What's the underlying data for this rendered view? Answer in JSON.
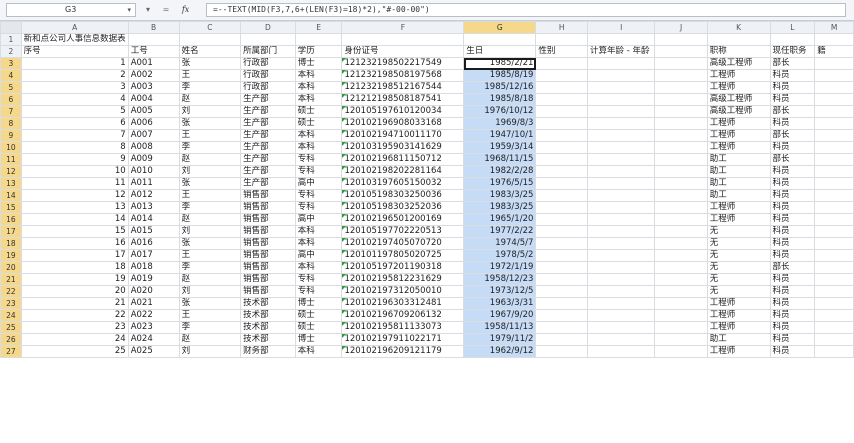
{
  "formula_bar": {
    "name_box": "G3",
    "name_box_arrow": "▾",
    "cancel_glyph": "▾",
    "confirm_glyph": "=",
    "fx_label": "fx",
    "formula": "=--TEXT(MID(F3,7,6+(LEN(F3)=18)*2),\"#-00-00\")"
  },
  "columns": [
    "",
    "A",
    "B",
    "C",
    "D",
    "E",
    "F",
    "G",
    "H",
    "I",
    "J",
    "K",
    "L",
    "M"
  ],
  "rows": [
    {
      "n": "1",
      "cells": [
        "新和点公司人事信息数据表",
        "",
        "",
        "",
        "",
        "",
        "",
        "",
        "",
        "",
        "",
        "",
        ""
      ]
    },
    {
      "n": "2",
      "cells": [
        "序号",
        "工号",
        "姓名",
        "所属部门",
        "学历",
        "身份证号",
        "生日",
        "性别",
        "计算年龄 - 年龄",
        "",
        "职称",
        "现任职务",
        "籍"
      ]
    },
    {
      "n": "3",
      "cells": [
        "1",
        "A001",
        "张",
        "行政部",
        "博士",
        "121232198502217549",
        "1985/2/21",
        "",
        "",
        "",
        "高级工程师",
        "部长",
        ""
      ]
    },
    {
      "n": "4",
      "cells": [
        "2",
        "A002",
        "王",
        "行政部",
        "本科",
        "121232198508197568",
        "1985/8/19",
        "",
        "",
        "",
        "工程师",
        "科员",
        ""
      ]
    },
    {
      "n": "5",
      "cells": [
        "3",
        "A003",
        "李",
        "行政部",
        "本科",
        "121232198512167544",
        "1985/12/16",
        "",
        "",
        "",
        "工程师",
        "科员",
        ""
      ]
    },
    {
      "n": "6",
      "cells": [
        "4",
        "A004",
        "赵",
        "生产部",
        "本科",
        "121212198508187541",
        "1985/8/18",
        "",
        "",
        "",
        "高级工程师",
        "科员",
        ""
      ]
    },
    {
      "n": "7",
      "cells": [
        "5",
        "A005",
        "刘",
        "生产部",
        "硕士",
        "120105197610120034",
        "1976/10/12",
        "",
        "",
        "",
        "高级工程师",
        "部长",
        ""
      ]
    },
    {
      "n": "8",
      "cells": [
        "6",
        "A006",
        "张",
        "生产部",
        "硕士",
        "120102196908033168",
        "1969/8/3",
        "",
        "",
        "",
        "工程师",
        "科员",
        ""
      ]
    },
    {
      "n": "9",
      "cells": [
        "7",
        "A007",
        "王",
        "生产部",
        "本科",
        "120102194710011170",
        "1947/10/1",
        "",
        "",
        "",
        "工程师",
        "部长",
        ""
      ]
    },
    {
      "n": "10",
      "cells": [
        "8",
        "A008",
        "李",
        "生产部",
        "本科",
        "120103195903141629",
        "1959/3/14",
        "",
        "",
        "",
        "工程师",
        "科员",
        ""
      ]
    },
    {
      "n": "11",
      "cells": [
        "9",
        "A009",
        "赵",
        "生产部",
        "专科",
        "120102196811150712",
        "1968/11/15",
        "",
        "",
        "",
        "助工",
        "部长",
        ""
      ]
    },
    {
      "n": "12",
      "cells": [
        "10",
        "A010",
        "刘",
        "生产部",
        "专科",
        "120102198202281164",
        "1982/2/28",
        "",
        "",
        "",
        "助工",
        "科员",
        ""
      ]
    },
    {
      "n": "13",
      "cells": [
        "11",
        "A011",
        "张",
        "生产部",
        "高中",
        "120103197605150032",
        "1976/5/15",
        "",
        "",
        "",
        "助工",
        "科员",
        ""
      ]
    },
    {
      "n": "14",
      "cells": [
        "12",
        "A012",
        "王",
        "销售部",
        "专科",
        "120105198303250036",
        "1983/3/25",
        "",
        "",
        "",
        "助工",
        "科员",
        ""
      ]
    },
    {
      "n": "15",
      "cells": [
        "13",
        "A013",
        "李",
        "销售部",
        "专科",
        "120105198303252036",
        "1983/3/25",
        "",
        "",
        "",
        "工程师",
        "科员",
        ""
      ]
    },
    {
      "n": "16",
      "cells": [
        "14",
        "A014",
        "赵",
        "销售部",
        "高中",
        "120102196501200169",
        "1965/1/20",
        "",
        "",
        "",
        "工程师",
        "科员",
        ""
      ]
    },
    {
      "n": "17",
      "cells": [
        "15",
        "A015",
        "刘",
        "销售部",
        "本科",
        "120105197702220513",
        "1977/2/22",
        "",
        "",
        "",
        "无",
        "科员",
        ""
      ]
    },
    {
      "n": "18",
      "cells": [
        "16",
        "A016",
        "张",
        "销售部",
        "本科",
        "120102197405070720",
        "1974/5/7",
        "",
        "",
        "",
        "无",
        "科员",
        ""
      ]
    },
    {
      "n": "19",
      "cells": [
        "17",
        "A017",
        "王",
        "销售部",
        "高中",
        "120101197805020725",
        "1978/5/2",
        "",
        "",
        "",
        "无",
        "科员",
        ""
      ]
    },
    {
      "n": "20",
      "cells": [
        "18",
        "A018",
        "李",
        "销售部",
        "本科",
        "120105197201190318",
        "1972/1/19",
        "",
        "",
        "",
        "无",
        "部长",
        ""
      ]
    },
    {
      "n": "21",
      "cells": [
        "19",
        "A019",
        "赵",
        "销售部",
        "专科",
        "120102195812231629",
        "1958/12/23",
        "",
        "",
        "",
        "无",
        "科员",
        ""
      ]
    },
    {
      "n": "22",
      "cells": [
        "20",
        "A020",
        "刘",
        "销售部",
        "专科",
        "120102197312050010",
        "1973/12/5",
        "",
        "",
        "",
        "无",
        "科员",
        ""
      ]
    },
    {
      "n": "23",
      "cells": [
        "21",
        "A021",
        "张",
        "技术部",
        "博士",
        "120102196303312481",
        "1963/3/31",
        "",
        "",
        "",
        "工程师",
        "科员",
        ""
      ]
    },
    {
      "n": "24",
      "cells": [
        "22",
        "A022",
        "王",
        "技术部",
        "硕士",
        "120102196709206132",
        "1967/9/20",
        "",
        "",
        "",
        "工程师",
        "科员",
        ""
      ]
    },
    {
      "n": "25",
      "cells": [
        "23",
        "A023",
        "李",
        "技术部",
        "硕士",
        "120102195811133073",
        "1958/11/13",
        "",
        "",
        "",
        "工程师",
        "科员",
        ""
      ]
    },
    {
      "n": "26",
      "cells": [
        "24",
        "A024",
        "赵",
        "技术部",
        "博士",
        "120102197911022171",
        "1979/11/2",
        "",
        "",
        "",
        "助工",
        "科员",
        ""
      ]
    },
    {
      "n": "27",
      "cells": [
        "25",
        "A025",
        "刘",
        "财务部",
        "本科",
        "120102196209121179",
        "1962/9/12",
        "",
        "",
        "",
        "工程师",
        "科员",
        ""
      ]
    }
  ]
}
